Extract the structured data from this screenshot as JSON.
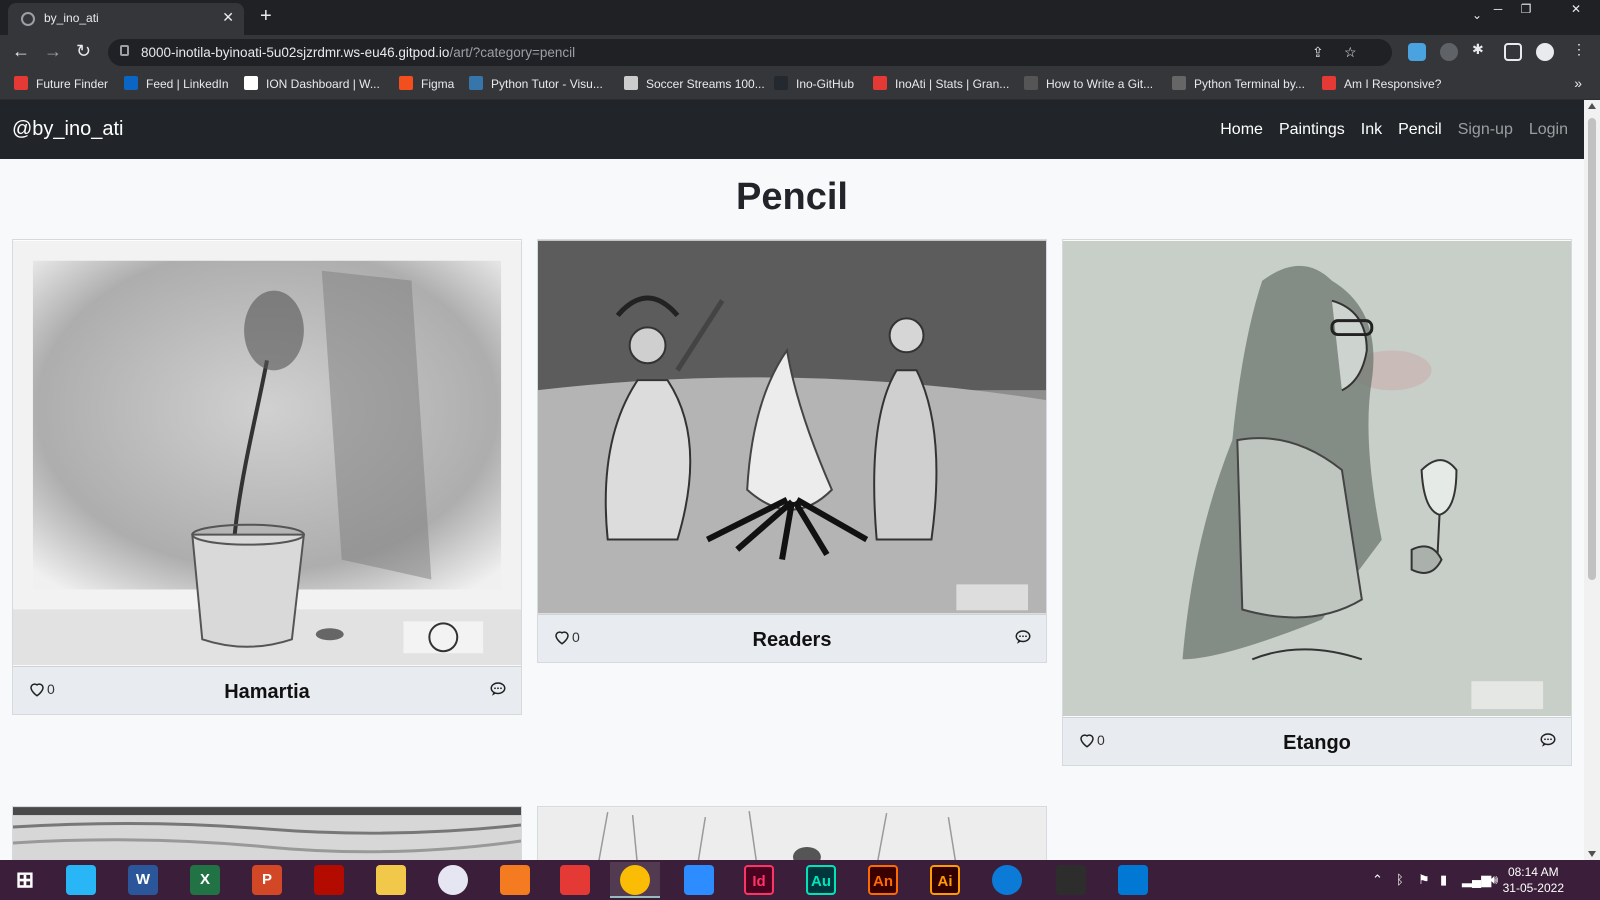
{
  "browser": {
    "tab_title": "by_ino_ati",
    "url_host": "8000-inotila-byinoati-5u02sjzrdmr.ws-eu46.gitpod.io",
    "url_path": "/art/?category=pencil",
    "bookmarks": [
      {
        "label": "Future Finder",
        "color": "#e53935"
      },
      {
        "label": "Feed | LinkedIn",
        "color": "#0a66c2"
      },
      {
        "label": "ION Dashboard | W...",
        "color": "#ffffff"
      },
      {
        "label": "Figma",
        "color": "#f24e1e"
      },
      {
        "label": "Python Tutor - Visu...",
        "color": "#3776ab"
      },
      {
        "label": "Soccer Streams 100...",
        "color": "#cccccc"
      },
      {
        "label": "Ino-GitHub",
        "color": "#24292f"
      },
      {
        "label": "InoAti | Stats | Gran...",
        "color": "#e53935"
      },
      {
        "label": "How to Write a Git...",
        "color": "#555555"
      },
      {
        "label": "Python Terminal by...",
        "color": "#666666"
      },
      {
        "label": "Am I Responsive?",
        "color": "#e53935"
      }
    ]
  },
  "site": {
    "brand": "@by_ino_ati",
    "nav": [
      {
        "label": "Home",
        "active": true
      },
      {
        "label": "Paintings",
        "active": true
      },
      {
        "label": "Ink",
        "active": true
      },
      {
        "label": "Pencil",
        "active": true
      },
      {
        "label": "Sign-up",
        "active": false
      },
      {
        "label": "Login",
        "active": false
      }
    ],
    "page_title": "Pencil",
    "artworks": [
      {
        "title": "Hamartia",
        "likes": "0",
        "subject": "flower in glass vase"
      },
      {
        "title": "Readers",
        "likes": "0",
        "subject": "two figures around a campfire"
      },
      {
        "title": "Etango",
        "likes": "0",
        "subject": "woman with wine glass"
      }
    ]
  },
  "taskbar": {
    "apps": [
      "start",
      "control-panel",
      "word",
      "excel",
      "powerpoint",
      "acrobat",
      "file-explorer",
      "itunes",
      "vlc",
      "media",
      "chrome",
      "zoom",
      "indesign",
      "audition",
      "animate",
      "illustrator",
      "edge",
      "terminal",
      "vscode"
    ],
    "labels": {
      "indesign": "Id",
      "audition": "Au",
      "animate": "An",
      "illustrator": "Ai",
      "word": "W",
      "excel": "X",
      "powerpoint": "P"
    },
    "time": "08:14 AM",
    "date": "31-05-2022"
  }
}
